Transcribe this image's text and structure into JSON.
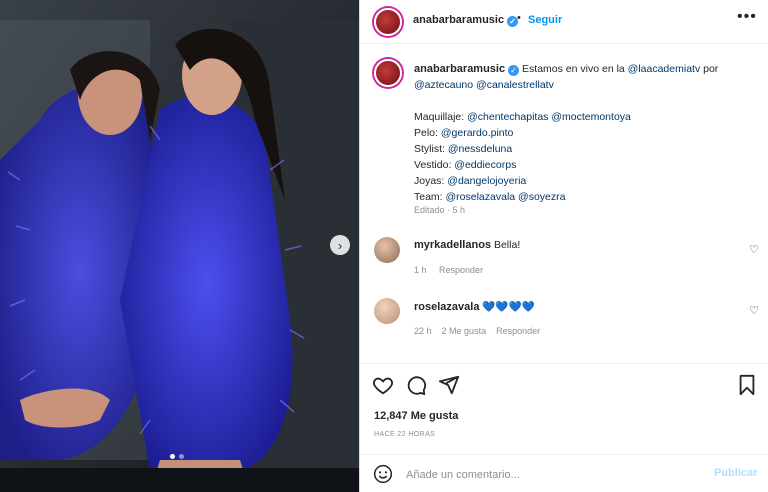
{
  "post": {
    "username": "anabarbaramusic",
    "follow_label": "Seguir",
    "dot_separator": "•",
    "caption_intro": "Estamos en vivo en la",
    "caption_por": "por",
    "mentions": {
      "laacademiatv": "@laacademiatv",
      "aztecauno": "@aztecauno",
      "canalestrellatv": "@canalestrellatv",
      "chentechapitas": "@chentechapitas",
      "moctemontoya": "@moctemontoya",
      "gerardo": "@gerardo.pinto",
      "nessdeluna": "@nessdeluna",
      "eddiecorps": "@eddiecorps",
      "dangelojoyeria": "@dangelojoyeria",
      "roselazavala": "@roselazavala",
      "soyezra": "@soyezra"
    },
    "labels": {
      "maquillaje": "Maquillaje:",
      "pelo": "Pelo:",
      "stylist": "Stylist:",
      "vestido": "Vestido:",
      "joyas": "Joyas:",
      "team": "Team:"
    },
    "caption_meta": "Editado · 5 h",
    "likes": "12,847 Me gusta",
    "time_ago": "HACE 22 HORAS"
  },
  "comments": [
    {
      "username": "myrkadellanos",
      "text": "Bella!",
      "meta_time": "1 h",
      "reply": "Responder",
      "likes": ""
    },
    {
      "username": "roselazavala",
      "text": "💙💙💙💙",
      "meta_time": "22 h",
      "reply": "Responder",
      "likes": "2 Me gusta"
    }
  ],
  "add_comment": {
    "placeholder": "Añade un comentario...",
    "publish": "Publicar"
  },
  "carousel": {
    "current": 1,
    "total": 2
  },
  "colors": {
    "accent": "#0095f6",
    "dress": "#2e2fd6",
    "verified": "#3897f0"
  },
  "icons": [
    "heart-icon",
    "comment-icon",
    "share-icon",
    "bookmark-icon",
    "emoji-icon",
    "more-icon",
    "chevron-right-icon",
    "verified-icon"
  ]
}
